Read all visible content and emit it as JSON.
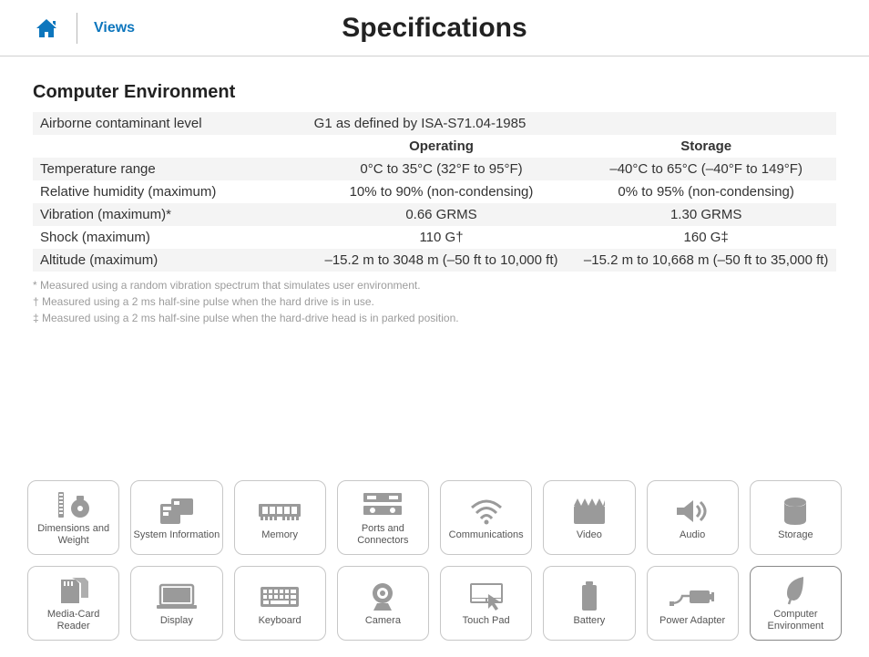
{
  "header": {
    "views_label": "Views",
    "page_title": "Specifications"
  },
  "section": {
    "title": "Computer Environment",
    "columns": {
      "operating": "Operating",
      "storage": "Storage"
    },
    "rows": {
      "airborne": {
        "label": "Airborne contaminant level",
        "value": "G1 as defined by ISA-S71.04-1985"
      },
      "temp": {
        "label": "Temperature range",
        "operating": "0°C to 35°C (32°F to 95°F)",
        "storage": "–40°C to 65°C (–40°F to 149°F)"
      },
      "humidity": {
        "label": "Relative humidity (maximum)",
        "operating": "10% to 90% (non-condensing)",
        "storage": "0% to 95% (non-condensing)"
      },
      "vibration": {
        "label": "Vibration (maximum)*",
        "operating": "0.66 GRMS",
        "storage": "1.30 GRMS"
      },
      "shock": {
        "label": "Shock (maximum)",
        "operating": "110 G†",
        "storage": "160 G‡"
      },
      "altitude": {
        "label": "Altitude (maximum)",
        "operating": "–15.2 m to 3048 m (–50 ft to 10,000 ft)",
        "storage": "–15.2 m to 10,668 m (–50 ft to 35,000 ft)"
      }
    },
    "footnotes": {
      "a": "* Measured using a random vibration spectrum that simulates user environment.",
      "b": "† Measured using a 2 ms half-sine pulse when the hard drive is in use.",
      "c": "‡ Measured using a 2 ms half-sine pulse when the hard-drive head is in parked position."
    }
  },
  "tiles": {
    "r1": {
      "dimensions": "Dimensions and Weight",
      "sysinfo": "System Information",
      "memory": "Memory",
      "ports": "Ports and Connectors",
      "comm": "Communications",
      "video": "Video",
      "audio": "Audio",
      "storage": "Storage"
    },
    "r2": {
      "mediacard": "Media-Card Reader",
      "display": "Display",
      "keyboard": "Keyboard",
      "camera": "Camera",
      "touchpad": "Touch Pad",
      "battery": "Battery",
      "power": "Power Adapter",
      "env": "Computer Environment"
    }
  }
}
